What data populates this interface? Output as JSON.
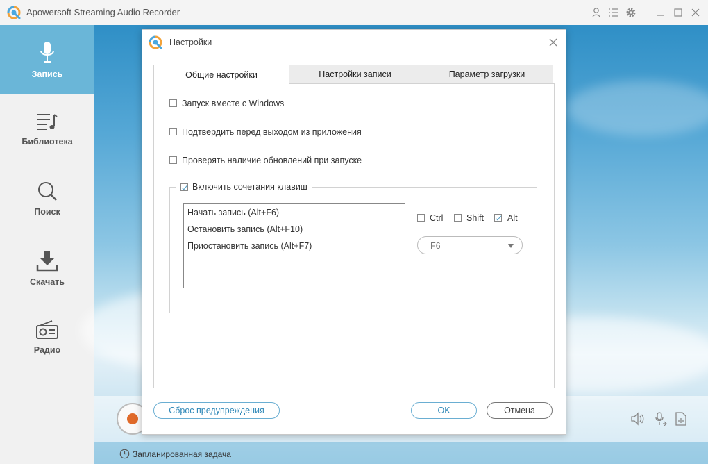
{
  "app": {
    "title": "Apowersoft Streaming Audio Recorder"
  },
  "sidebar": {
    "items": [
      {
        "label": "Запись",
        "icon": "microphone-icon",
        "active": true
      },
      {
        "label": "Библиотека",
        "icon": "music-list-icon",
        "active": false
      },
      {
        "label": "Поиск",
        "icon": "search-icon",
        "active": false
      },
      {
        "label": "Скачать",
        "icon": "download-icon",
        "active": false
      },
      {
        "label": "Радио",
        "icon": "radio-icon",
        "active": false
      }
    ]
  },
  "status": {
    "scheduled_task": "Запланированная задача"
  },
  "dialog": {
    "title": "Настройки",
    "tabs": [
      {
        "label": "Общие настройки",
        "active": true
      },
      {
        "label": "Настройки записи",
        "active": false
      },
      {
        "label": "Параметр загрузки",
        "active": false
      }
    ],
    "options": [
      {
        "label": "Запуск вместе с Windows",
        "checked": false
      },
      {
        "label": "Подтвердить перед выходом из приложения",
        "checked": false
      },
      {
        "label": "Проверять наличие обновлений при запуске",
        "checked": false
      }
    ],
    "hotkeys": {
      "enable_label": "Включить сочетания клавиш",
      "enabled": true,
      "items": [
        "Начать запись (Alt+F6)",
        "Остановить запись (Alt+F10)",
        "Приостановить запись (Alt+F7)"
      ],
      "modifiers": [
        {
          "label": "Ctrl",
          "checked": false
        },
        {
          "label": "Shift",
          "checked": false
        },
        {
          "label": "Alt",
          "checked": true
        }
      ],
      "key_value": "F6"
    },
    "buttons": {
      "reset": "Сброс предупреждения",
      "ok": "OK",
      "cancel": "Отмена"
    }
  },
  "colors": {
    "accent": "#6ab6d8",
    "button_blue": "#2f88b8",
    "record_dot": "#e06a2a"
  }
}
